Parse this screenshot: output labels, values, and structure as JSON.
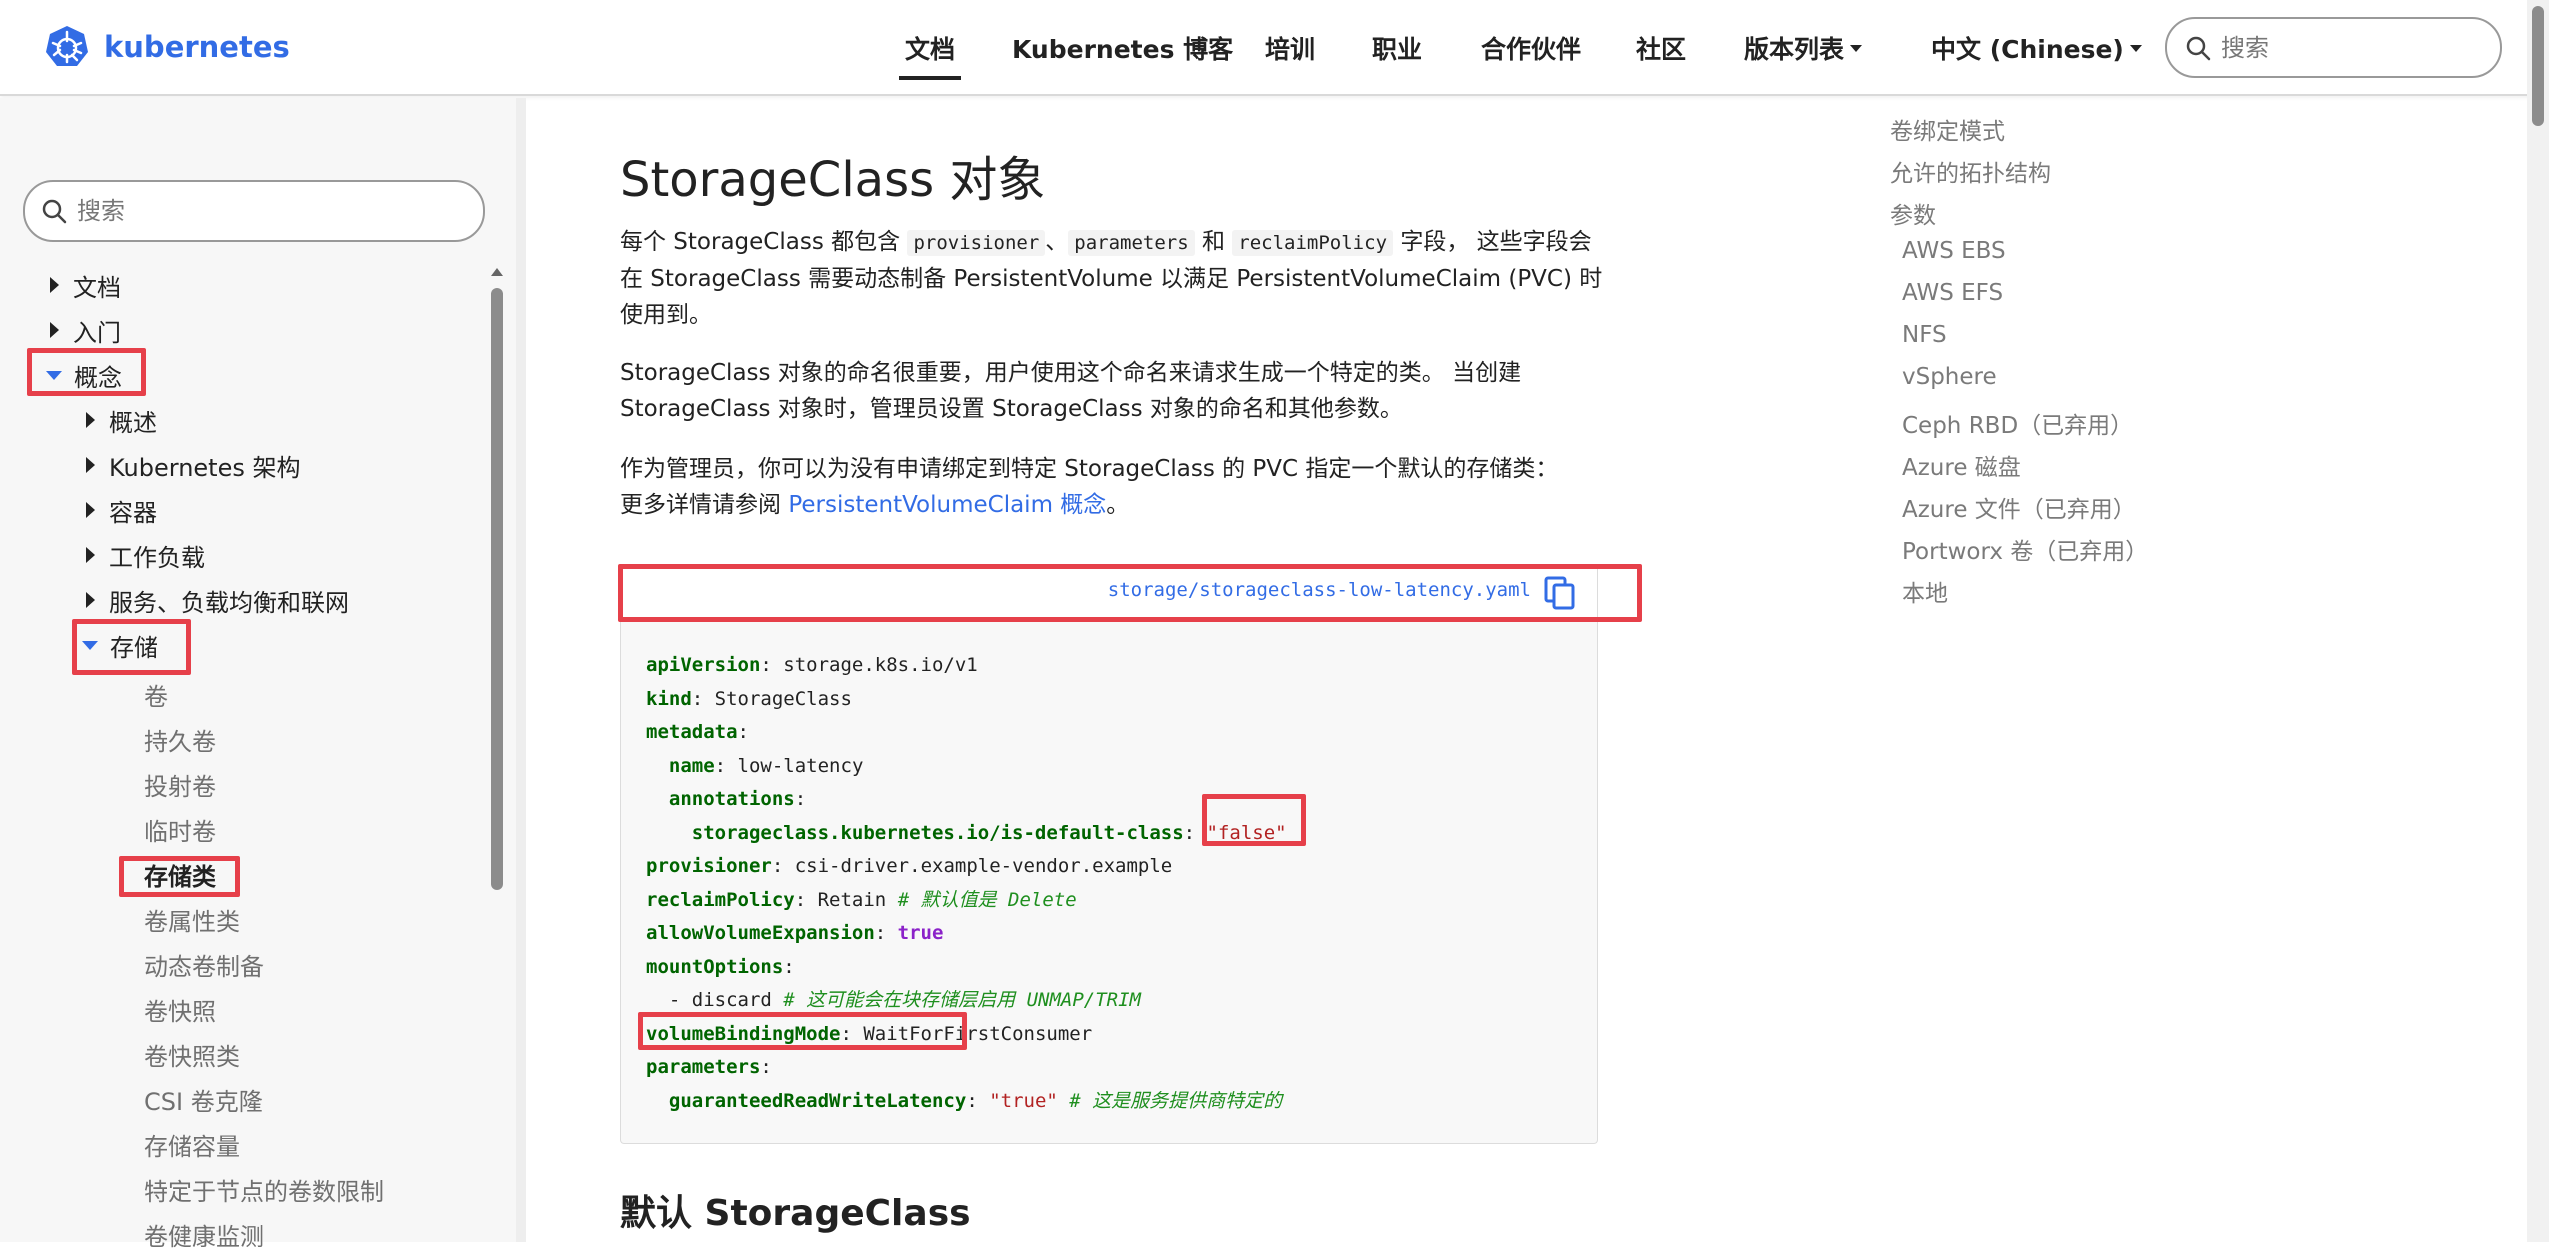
{
  "header": {
    "logo_text": "kubernetes",
    "nav": [
      {
        "label": "文档",
        "active": true
      },
      {
        "label": "Kubernetes 博客"
      },
      {
        "label": "培训"
      },
      {
        "label": "职业"
      },
      {
        "label": "合作伙伴"
      },
      {
        "label": "社区"
      },
      {
        "label": "版本列表",
        "dropdown": true
      },
      {
        "label": "中文 (Chinese)",
        "dropdown": true
      }
    ],
    "search_placeholder": "搜索"
  },
  "sidebar": {
    "search_placeholder": "搜索",
    "items": [
      {
        "label": "文档",
        "state": "collapsed"
      },
      {
        "label": "入门",
        "state": "collapsed"
      },
      {
        "label": "概念",
        "state": "expanded"
      },
      {
        "label": "概述",
        "state": "collapsed"
      },
      {
        "label": "Kubernetes 架构",
        "state": "collapsed"
      },
      {
        "label": "容器",
        "state": "collapsed"
      },
      {
        "label": "工作负载",
        "state": "collapsed"
      },
      {
        "label": "服务、负载均衡和联网",
        "state": "collapsed"
      },
      {
        "label": "存储",
        "state": "expanded"
      },
      {
        "label": "卷"
      },
      {
        "label": "持久卷"
      },
      {
        "label": "投射卷"
      },
      {
        "label": "临时卷"
      },
      {
        "label": "存储类",
        "current": true
      },
      {
        "label": "卷属性类"
      },
      {
        "label": "动态卷制备"
      },
      {
        "label": "卷快照"
      },
      {
        "label": "卷快照类"
      },
      {
        "label": "CSI 卷克隆"
      },
      {
        "label": "存储容量"
      },
      {
        "label": "特定于节点的卷数限制"
      },
      {
        "label": "卷健康监测"
      }
    ]
  },
  "main": {
    "title": "StorageClass 对象",
    "p1": {
      "t1": "每个 StorageClass 都包含 ",
      "c1": "provisioner",
      "t2": "、",
      "c2": "parameters",
      "t3": " 和 ",
      "c3": "reclaimPolicy",
      "t4": " 字段， 这些字段会",
      "line2": "在 StorageClass 需要动态制备 PersistentVolume 以满足 PersistentVolumeClaim (PVC) 时",
      "line3": "使用到。"
    },
    "p2": {
      "line1": "StorageClass 对象的命名很重要，用户使用这个命名来请求生成一个特定的类。 当创建",
      "line2": "StorageClass 对象时，管理员设置 StorageClass 对象的命名和其他参数。"
    },
    "p3": {
      "line1": "作为管理员，你可以为没有申请绑定到特定 StorageClass 的 PVC 指定一个默认的存储类：",
      "t1": "更多详情请参阅 ",
      "link": "PersistentVolumeClaim 概念",
      "t2": "。"
    },
    "code": {
      "file": "storage/storageclass-low-latency.yaml",
      "l1k": "apiVersion",
      "l1v": " storage.k8s.io/v1",
      "l2k": "kind",
      "l2v": " StorageClass",
      "l3k": "metadata",
      "l4k": "name",
      "l4v": " low-latency",
      "l5k": "annotations",
      "l6k": "storageclass.kubernetes.io/is-default-class",
      "l6v": "\"false\"",
      "l7k": "provisioner",
      "l7v": " csi-driver.example-vendor.example",
      "l8k": "reclaimPolicy",
      "l8v": " Retain ",
      "l8c": "# 默认值是 Delete",
      "l9k": "allowVolumeExpansion",
      "l9v": "true",
      "l10k": "mountOptions",
      "l11v": "- discard ",
      "l11c": "# 这可能会在块存储层启用 UNMAP/TRIM",
      "l12k": "volumeBindingMode",
      "l12v": " WaitForFirstConsumer",
      "l13k": "parameters",
      "l14k": "guaranteedReadWriteLatency",
      "l14v": "\"true\"",
      "l14c": " # 这是服务提供商特定的"
    },
    "h2": "默认 StorageClass"
  },
  "toc": [
    "卷绑定模式",
    "允许的拓扑结构",
    "参数",
    "AWS EBS",
    "AWS EFS",
    "NFS",
    "vSphere",
    "Ceph RBD（已弃用）",
    "Azure 磁盘",
    "Azure 文件（已弃用）",
    "Portworx 卷（已弃用）",
    "本地"
  ],
  "colors": {
    "brand": "#326ce5",
    "highlight": "#e6404a"
  }
}
